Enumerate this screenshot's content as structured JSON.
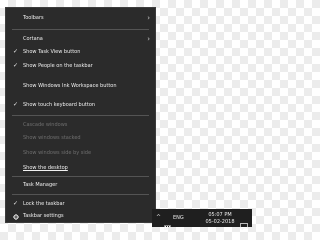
{
  "context_menu": {
    "items": [
      {
        "label": "Toolbars",
        "submenu_icon": "chevron-right-icon"
      },
      {
        "label": "Cortana",
        "submenu_icon": "chevron-right-icon"
      },
      {
        "label": "Show Task View button",
        "checked": true
      },
      {
        "label": "Show People on the taskbar",
        "checked": true
      },
      {
        "label": "Show Windows Ink Workspace button",
        "checked": false
      },
      {
        "label": "Show touch keyboard button",
        "checked": true
      },
      {
        "label": "Cascade windows",
        "enabled": false
      },
      {
        "label": "Show windows stacked",
        "enabled": false
      },
      {
        "label": "Show windows side by side",
        "enabled": false
      },
      {
        "label": "Show the desktop"
      },
      {
        "label": "Task Manager"
      },
      {
        "label": "Lock the taskbar",
        "checked": true
      },
      {
        "label": "Taskbar settings",
        "icon": "gear-icon"
      }
    ],
    "check_glyph": "✓",
    "chevron_glyph": "›"
  },
  "taskbar": {
    "overflow_glyph": "^",
    "keyboard_icon": "keyboard-icon",
    "language": "ENG",
    "time": "05:07 PM",
    "date": "05-02-2018",
    "notification_icon": "notification-icon"
  },
  "colors": {
    "menu_bg": "#2b2b2b",
    "menu_text": "#f2f2f2",
    "disabled_text": "#6f6f6f",
    "taskbar_bg": "#1f1f1f"
  }
}
